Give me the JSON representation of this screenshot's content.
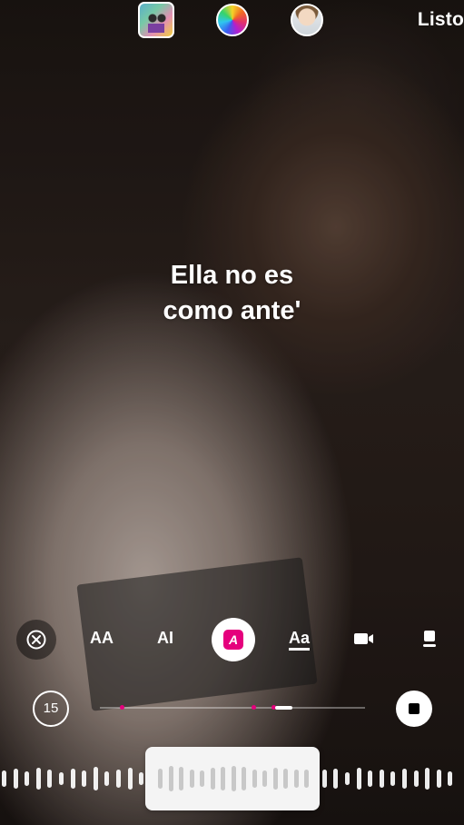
{
  "topbar": {
    "album_icon": "album-art-icon",
    "color_icon": "color-wheel-icon",
    "avatar_icon": "avatar-icon",
    "done_label": "Listo"
  },
  "lyrics": {
    "line1": "Ella no es",
    "line2": "como ante'"
  },
  "style_options": [
    {
      "icon": "close-icon"
    },
    {
      "label": "AA",
      "icon": "text-style-full-icon"
    },
    {
      "label": "AI",
      "icon": "text-style-karaoke-icon"
    },
    {
      "label": "A",
      "icon": "text-style-highlight-icon",
      "selected": true
    },
    {
      "label": "Aa",
      "icon": "text-style-underline-icon"
    },
    {
      "icon": "video-icon"
    },
    {
      "icon": "card-icon"
    }
  ],
  "player": {
    "duration_label": "15",
    "stop_icon": "stop-icon",
    "accent_color": "#e5007d"
  }
}
